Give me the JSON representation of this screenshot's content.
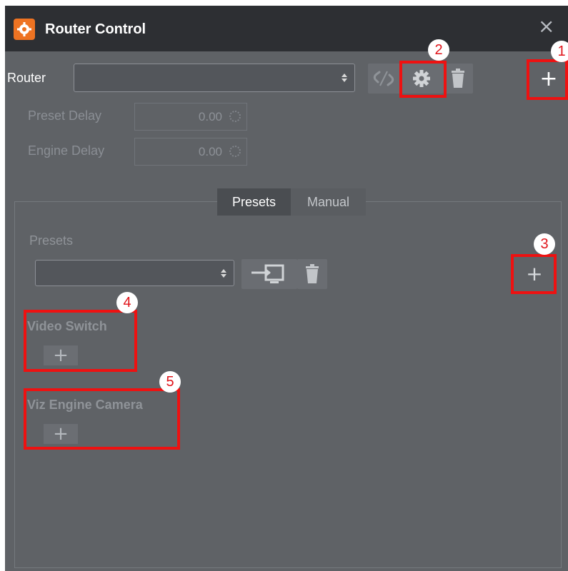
{
  "window": {
    "title": "Router Control",
    "close_symbol": "×",
    "accent": "#ee7322"
  },
  "router": {
    "label": "Router",
    "selected_value": "",
    "preset_delay_label": "Preset Delay",
    "preset_delay_value": "0.00",
    "engine_delay_label": "Engine Delay",
    "engine_delay_value": "0.00",
    "add_symbol": "+"
  },
  "tabs": [
    {
      "label": "Presets",
      "active": true
    },
    {
      "label": "Manual",
      "active": false
    }
  ],
  "presets": {
    "label": "Presets",
    "selected_value": "",
    "add_symbol": "+"
  },
  "video_switch": {
    "label": "Video Switch",
    "add_symbol": "+"
  },
  "viz_engine_camera": {
    "label": "Viz Engine Camera",
    "add_symbol": "+"
  },
  "callouts": [
    "1",
    "2",
    "3",
    "4",
    "5"
  ],
  "icons": {
    "app": "gear-icon",
    "link": "unlink-icon",
    "settings": "gear-icon",
    "delete": "trash-icon",
    "apply": "screen-enter-icon"
  },
  "highlight_color": "#ee1111"
}
